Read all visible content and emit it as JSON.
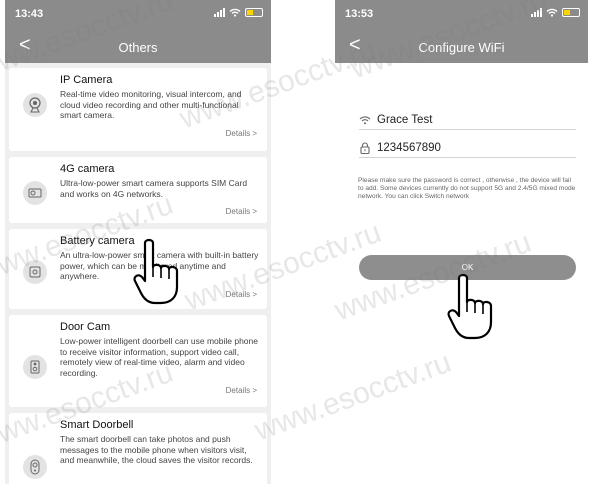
{
  "left_screen": {
    "status": {
      "time": "13:43"
    },
    "nav": {
      "back_glyph": "<",
      "title": "Others"
    },
    "items": [
      {
        "name": "IP Camera",
        "description": "Real-time video monitoring, visual intercom, and cloud video recording and other multi-functional smart camera.",
        "details": "Details >",
        "icon": "ip-camera-icon"
      },
      {
        "name": "4G camera",
        "description": "Ultra-low-power smart camera supports SIM Card and works on 4G networks.",
        "details": "Details >",
        "icon": "4g-camera-icon"
      },
      {
        "name": "Battery camera",
        "description": "An ultra-low-power smart camera with built-in battery power, which can be monitored anytime and anywhere.",
        "details": "Details >",
        "icon": "battery-camera-icon"
      },
      {
        "name": "Door Cam",
        "description": "Low-power intelligent doorbell can use mobile phone to receive visitor information, support video call, remotely view of real-time video, alarm and video recording.",
        "details": "Details >",
        "icon": "door-cam-icon"
      },
      {
        "name": "Smart Doorbell",
        "description": "The smart doorbell can take photos and push messages to the mobile phone when visitors visit, and meanwhile, the cloud saves the visitor records.",
        "details": "",
        "icon": "doorbell-icon"
      }
    ]
  },
  "right_screen": {
    "status": {
      "time": "13:53"
    },
    "nav": {
      "back_glyph": "<",
      "title": "Configure WiFi"
    },
    "ssid": "Grace Test",
    "password": "1234567890",
    "hint": "Please make sure the password is correct , otherwise , the device will fail to add. Some devices currently do not support 5G and 2.4/5G mixed mode network. You can click Switch network",
    "ok_label": "OK"
  },
  "watermark": {
    "text": "www.esocctv.ru",
    "color": "#787878"
  }
}
